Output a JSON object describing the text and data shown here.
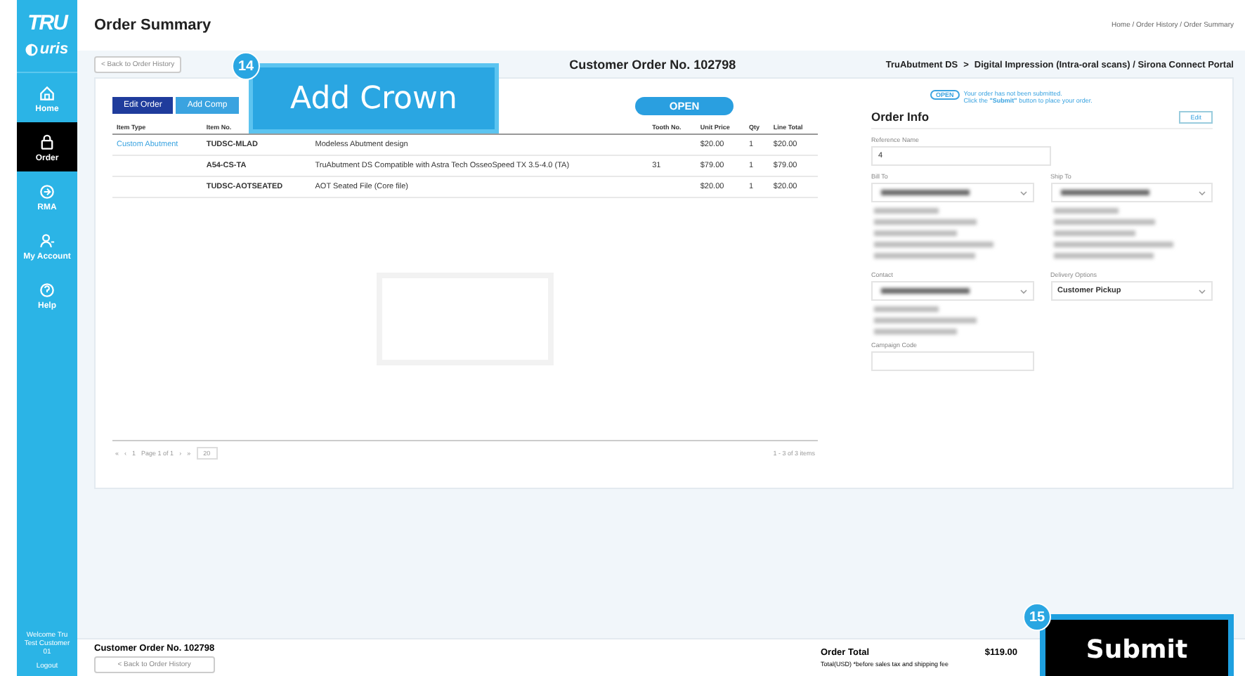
{
  "sidebar": {
    "logo": "TRU",
    "brand": "uris",
    "items": [
      {
        "label": "Home",
        "selected": false
      },
      {
        "label": "Order",
        "selected": true
      },
      {
        "label": "RMA",
        "selected": false
      },
      {
        "label": "My Account",
        "selected": false
      },
      {
        "label": "Help",
        "selected": false
      }
    ],
    "welcome": "Welcome Tru Test Customer 01",
    "logout": "Logout"
  },
  "header": {
    "title": "Order Summary",
    "breadcrumb": "Home / Order History / Order Summary"
  },
  "subheader": {
    "back": "< Back to Order History",
    "order_no": "Customer Order No. 102798",
    "product": "TruAbutment DS",
    "separator": ">",
    "workflow": "Digital Impression (Intra-oral scans) / Sirona Connect Portal"
  },
  "toolbar": {
    "buttons": [
      "Edit Order",
      "Add Comp"
    ],
    "status": "OPEN"
  },
  "table": {
    "columns": [
      "Item Type",
      "Item No.",
      "Tooth No.",
      "Unit Price",
      "Qty",
      "Line Total"
    ],
    "rows": [
      {
        "item_type": "Custom Abutment",
        "item_no": "TUDSC-MLAD",
        "description": "Modeless Abutment design",
        "tooth_no": "",
        "unit_price": "$20.00",
        "qty": "1",
        "line_total": "$20.00"
      },
      {
        "item_type": "",
        "item_no": "A54-CS-TA",
        "description": "TruAbutment DS Compatible with Astra Tech OsseoSpeed TX 3.5-4.0 (TA)",
        "tooth_no": "31",
        "unit_price": "$79.00",
        "qty": "1",
        "line_total": "$79.00"
      },
      {
        "item_type": "",
        "item_no": "TUDSC-AOTSEATED",
        "description": "AOT Seated File (Core file)",
        "tooth_no": "",
        "unit_price": "$20.00",
        "qty": "1",
        "line_total": "$20.00"
      }
    ]
  },
  "pager": {
    "first": "«",
    "prev": "‹",
    "page": "1",
    "page_label": "Page 1 of 1",
    "next": "›",
    "last": "»",
    "page_size": "20",
    "items": "1 - 3 of 3 items"
  },
  "notice": {
    "badge": "OPEN",
    "line1": "Your order has not been submitted.",
    "line2": "Click the **\"Submit\"** button to place your order."
  },
  "order_info": {
    "title": "Order Info",
    "edit": "Edit",
    "reference_label": "Reference Name",
    "reference_value": "4",
    "bill_to_label": "Bill To",
    "ship_to_label": "Ship To",
    "contact_label": "Contact",
    "delivery_label": "Delivery Options",
    "delivery_value": "Customer Pickup",
    "campaign_label": "Campaign Code"
  },
  "footer": {
    "order_no": "Customer Order No. 102798",
    "back": "< Back to Order History",
    "total_label": "Order Total",
    "total": "$119.00",
    "note": "Total(USD) *before sales tax and shipping fee"
  },
  "callouts": [
    {
      "number": "14",
      "label": "Add Crown",
      "kind": "blue"
    },
    {
      "number": "15",
      "label": "Submit",
      "kind": "dark"
    }
  ]
}
